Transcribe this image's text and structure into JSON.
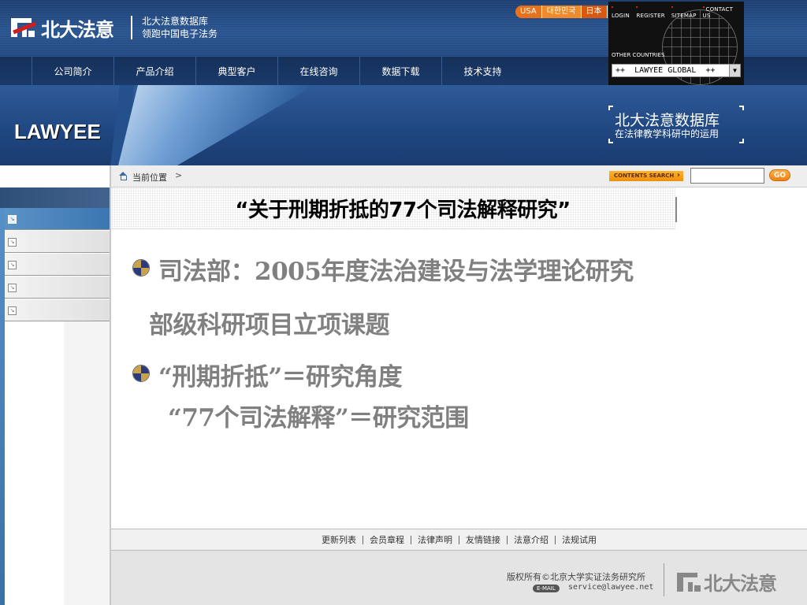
{
  "header": {
    "logo_text": "北大法意",
    "tagline_line1": "北大法意数据库",
    "tagline_line2": "领跑中国电子法务",
    "languages": [
      "USA",
      "대한민국",
      "日本"
    ],
    "top_links": [
      "LOGIN",
      "REGISTER",
      "SITEMAP",
      "CONTACT US"
    ],
    "other_countries_label": "OTHER COUNTRIES",
    "global_select_value": "++  LAWYEE GLOBAL  ++"
  },
  "nav": {
    "items": [
      "公司简介",
      "产品介绍",
      "典型客户",
      "在线咨询",
      "数据下载",
      "技术支持"
    ]
  },
  "banner": {
    "brand": "LAWYEE",
    "promo_title": "北大法意数据库",
    "promo_subtitle": "在法律教学科研中的运用"
  },
  "breadcrumb": {
    "label": "当前位置",
    "chevron": ">",
    "contents_search_label": "CONTENTS SEARCH",
    "search_value": "",
    "go_label": "GO"
  },
  "sidebar": {
    "items": [
      {
        "icon": "arrow-icon",
        "active": true
      },
      {
        "icon": "arrow-icon",
        "active": false
      },
      {
        "icon": "arrow-icon",
        "active": false
      },
      {
        "icon": "arrow-icon",
        "active": false
      },
      {
        "icon": "arrow-icon",
        "active": false
      }
    ]
  },
  "slide": {
    "title": "“关于刑期折抵的77个司法解释研究”",
    "bullet1_line1": "司法部：2005年度法治建设与法学理论研究",
    "bullet1_line2": "部级科研项目立项课题",
    "bullet2_line1": "“刑期折抵”＝研究角度",
    "bullet2_line2": "“77个司法解释”＝研究范围"
  },
  "footer": {
    "links": [
      "更新列表",
      "会员章程",
      "法律声明",
      "友情链接",
      "法意介绍",
      "法规试用"
    ],
    "copyright": "版权所有©北京大学实证法务研究所",
    "email_label": "E-MAIL",
    "email": "service@lawyee.net",
    "logo_text": "北大法意"
  },
  "colors": {
    "header_blue": "#244a82",
    "accent_orange": "#ee8f0c",
    "body_text_gray": "#808080"
  }
}
